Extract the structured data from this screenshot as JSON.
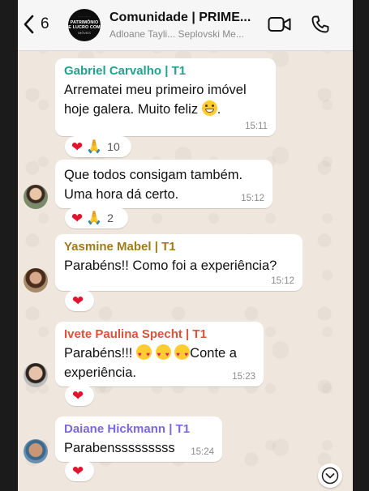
{
  "header": {
    "back_count": "6",
    "title": "Comunidade | PRIME...",
    "subtitle": "Adloane Tayli... Seplovski Me...",
    "avatar_lines": [
      "PATRIMÔNIO",
      "E LUCRO COM",
      "IMÓVEIS"
    ]
  },
  "messages": [
    {
      "sender": "Gabriel Carvalho | T1",
      "sender_color": "#1fa38f",
      "line1": "Arrematei meu primeiro imóvel",
      "line2": "hoje galera. Muito feliz",
      "line2_end": ".",
      "time": "15:11",
      "reaction_count": "10"
    },
    {
      "line1": "Que todos consigam também.",
      "line2": "Uma hora dá certo.",
      "time": "15:12",
      "reaction_count": "2"
    },
    {
      "sender": "Yasmine Mabel | T1",
      "sender_color": "#a07b1a",
      "line1": "Parabéns!! Como foi a experiência?",
      "time": "15:12"
    },
    {
      "sender": "Ivete Paulina Specht | T1",
      "sender_color": "#d9543a",
      "line1": "Parabéns!!!",
      "line1_end": "Conte a",
      "line2": "experiência.",
      "time": "15:23"
    },
    {
      "sender": "Daiane Hickmann | T1",
      "sender_color": "#7b68d9",
      "line1": "Parabensssssssss",
      "time": "15:24"
    }
  ],
  "icons": {
    "back": "chevron-left-icon",
    "video": "video-camera-icon",
    "call": "phone-icon",
    "scroll": "chevron-down-icon"
  }
}
